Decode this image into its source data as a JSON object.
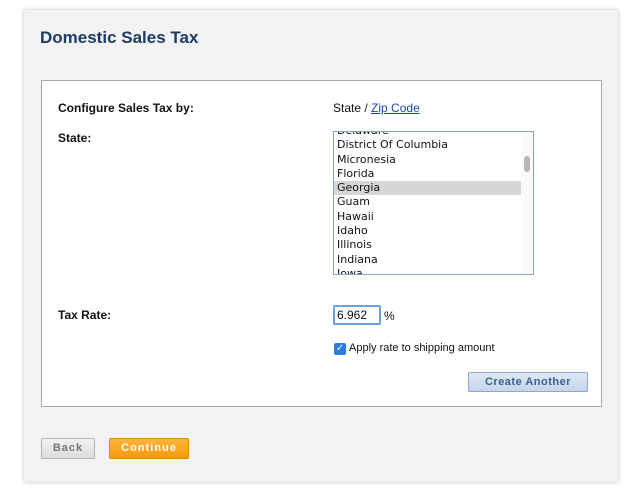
{
  "title": "Domestic Sales Tax",
  "configure": {
    "label": "Configure Sales Tax by:",
    "option_state": "State",
    "separator": " / ",
    "option_zip": "Zip Code"
  },
  "state": {
    "label": "State:",
    "options": [
      "Delaware",
      "District Of Columbia",
      "Micronesia",
      "Florida",
      "Georgia",
      "Guam",
      "Hawaii",
      "Idaho",
      "Illinois",
      "Indiana",
      "Iowa"
    ],
    "selected": "Georgia"
  },
  "tax_rate": {
    "label": "Tax Rate:",
    "value": "6.962",
    "unit": "%"
  },
  "apply_shipping": {
    "label": "Apply rate to shipping amount",
    "checked": true
  },
  "buttons": {
    "create_another": "Create Another",
    "back": "Back",
    "continue": "Continue"
  },
  "colors": {
    "title": "#1d3b63",
    "link": "#1a4aa8",
    "continue_button": "#f39a0f",
    "checkbox": "#2d7be5"
  }
}
